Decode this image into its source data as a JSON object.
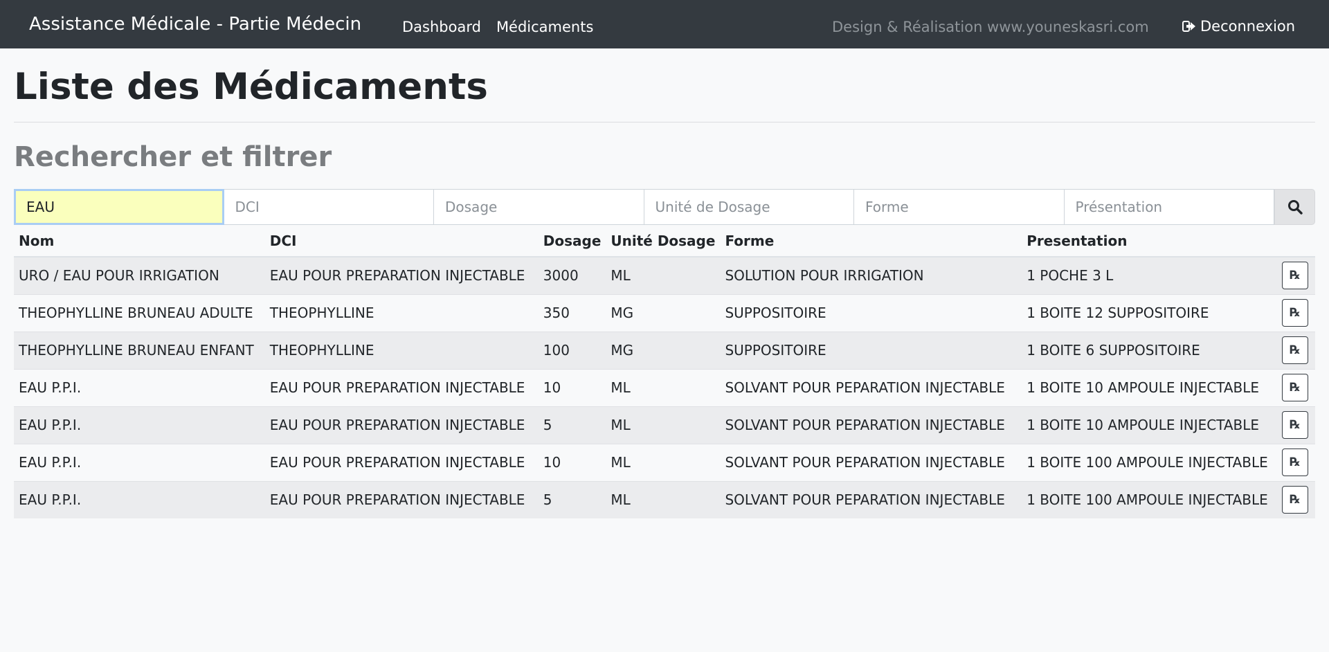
{
  "navbar": {
    "brand": "Assistance Médicale - Partie Médecin",
    "links": [
      "Dashboard",
      "Médicaments"
    ],
    "credit": "Design & Réalisation www.youneskasri.com",
    "logout": "Deconnexion"
  },
  "page": {
    "title": "Liste des Médicaments",
    "subtitle": "Rechercher et filtrer"
  },
  "filters": {
    "nom": {
      "value": "EAU",
      "placeholder": ""
    },
    "dci": {
      "placeholder": "DCI"
    },
    "dosage": {
      "placeholder": "Dosage"
    },
    "unite": {
      "placeholder": "Unité de Dosage"
    },
    "forme": {
      "placeholder": "Forme"
    },
    "presentation": {
      "placeholder": "Présentation"
    }
  },
  "table": {
    "headers": [
      "Nom",
      "DCI",
      "Dosage",
      "Unité Dosage",
      "Forme",
      "Presentation"
    ],
    "rows": [
      [
        "URO / EAU POUR IRRIGATION",
        "EAU POUR PREPARATION INJECTABLE",
        "3000",
        "ML",
        "SOLUTION POUR IRRIGATION",
        "1 POCHE 3 L"
      ],
      [
        "THEOPHYLLINE BRUNEAU ADULTE",
        "THEOPHYLLINE",
        "350",
        "MG",
        "SUPPOSITOIRE",
        "1 BOITE 12 SUPPOSITOIRE"
      ],
      [
        "THEOPHYLLINE BRUNEAU ENFANT",
        "THEOPHYLLINE",
        "100",
        "MG",
        "SUPPOSITOIRE",
        "1 BOITE 6 SUPPOSITOIRE"
      ],
      [
        "EAU P.P.I.",
        "EAU POUR PREPARATION INJECTABLE",
        "10",
        "ML",
        "SOLVANT POUR PEPARATION INJECTABLE",
        "1 BOITE 10 AMPOULE INJECTABLE"
      ],
      [
        "EAU P.P.I.",
        "EAU POUR PREPARATION INJECTABLE",
        "5",
        "ML",
        "SOLVANT POUR PEPARATION INJECTABLE",
        "1 BOITE 10 AMPOULE INJECTABLE"
      ],
      [
        "EAU P.P.I.",
        "EAU POUR PREPARATION INJECTABLE",
        "10",
        "ML",
        "SOLVANT POUR PEPARATION INJECTABLE",
        "1 BOITE 100 AMPOULE INJECTABLE"
      ],
      [
        "EAU P.P.I.",
        "EAU POUR PREPARATION INJECTABLE",
        "5",
        "ML",
        "SOLVANT POUR PEPARATION INJECTABLE",
        "1 BOITE 100 AMPOULE INJECTABLE"
      ]
    ],
    "action_icon": "prescription-icon",
    "action_label": "℞"
  },
  "colors": {
    "navbar": "#343a40",
    "background": "#f8f9fa",
    "autofill": "#faffbd",
    "focus_border": "#a9cdf4"
  }
}
